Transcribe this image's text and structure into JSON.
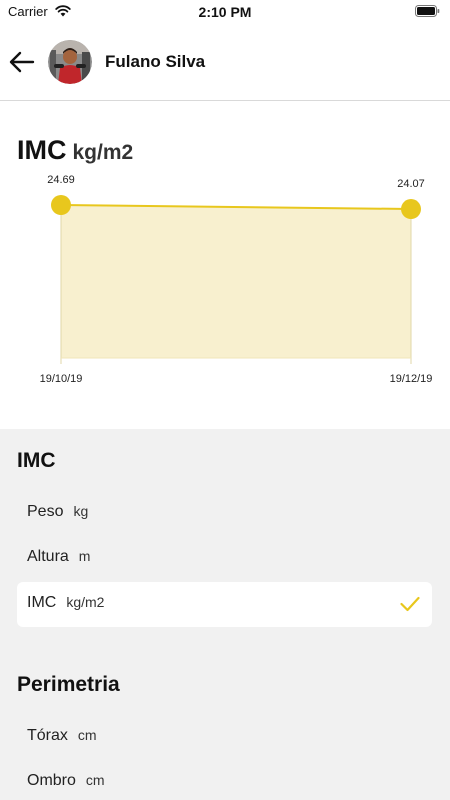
{
  "status_bar": {
    "carrier": "Carrier",
    "time": "2:10 PM"
  },
  "header": {
    "user_name": "Fulano Silva"
  },
  "chart": {
    "title": "IMC",
    "unit": "kg/m2"
  },
  "chart_data": {
    "type": "area",
    "title": "IMC kg/m2",
    "x": [
      "19/10/19",
      "19/12/19"
    ],
    "values": [
      24.69,
      24.07
    ],
    "data_labels": [
      "24.69",
      "24.07"
    ],
    "xlabel": "",
    "ylabel": "",
    "grid": false,
    "color": "#e8c71d",
    "fill_color": "#f8f0cf"
  },
  "groups": [
    {
      "title": "IMC",
      "items": [
        {
          "label": "Peso",
          "unit": "kg",
          "selected": false
        },
        {
          "label": "Altura",
          "unit": "m",
          "selected": false
        },
        {
          "label": "IMC",
          "unit": "kg/m2",
          "selected": true
        }
      ]
    },
    {
      "title": "Perimetria",
      "items": [
        {
          "label": "Tórax",
          "unit": "cm",
          "selected": false
        },
        {
          "label": "Ombro",
          "unit": "cm",
          "selected": false
        }
      ]
    }
  ],
  "colors": {
    "accent": "#e8c71d",
    "panel_bg": "#f1f1f1"
  },
  "icons": [
    "wifi-icon",
    "battery-icon",
    "back-arrow-icon",
    "check-icon"
  ]
}
